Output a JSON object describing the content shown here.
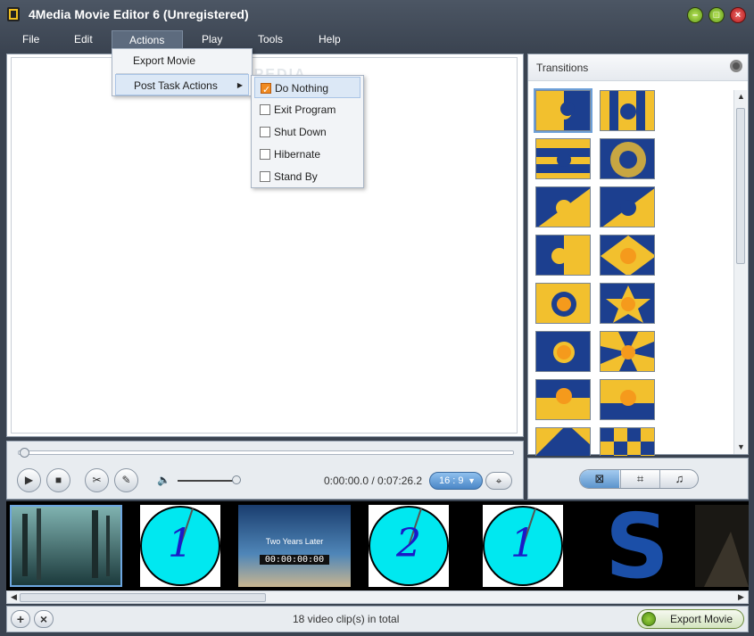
{
  "window": {
    "title": "4Media Movie Editor 6 (Unregistered)"
  },
  "menubar": [
    {
      "label": "File"
    },
    {
      "label": "Edit"
    },
    {
      "label": "Actions"
    },
    {
      "label": "Play"
    },
    {
      "label": "Tools"
    },
    {
      "label": "Help"
    }
  ],
  "actions_menu": {
    "items": [
      {
        "label": "Export Movie"
      },
      {
        "label": "Post Task Actions",
        "submenu_arrow": "▶"
      }
    ]
  },
  "post_task_menu": {
    "items": [
      {
        "label": "Do Nothing",
        "checked": true
      },
      {
        "label": "Exit Program",
        "checked": false
      },
      {
        "label": "Shut Down",
        "checked": false
      },
      {
        "label": "Hibernate",
        "checked": false
      },
      {
        "label": "Stand By",
        "checked": false
      }
    ]
  },
  "preview": {
    "watermark": "SOFTPEDIA"
  },
  "player": {
    "timecode": "0:00:00.0 / 0:07:26.2",
    "aspect_ratio": "16 : 9",
    "volume_level": 0.95,
    "seek_position": 0.0
  },
  "transitions": {
    "title": "Transitions",
    "tabs": [
      "transition-tab",
      "crop-tab",
      "music-tab"
    ]
  },
  "timeline": {
    "clips": [
      {
        "kind": "forest",
        "selected": true
      },
      {
        "kind": "clock",
        "numeral": "1"
      },
      {
        "kind": "beach",
        "caption": "Two Years Later",
        "timecode": "00:00:00:00"
      },
      {
        "kind": "clock",
        "numeral": "2"
      },
      {
        "kind": "clock",
        "numeral": "1"
      },
      {
        "kind": "letter",
        "glyph": "S"
      },
      {
        "kind": "dark"
      }
    ]
  },
  "footer": {
    "status": "18 video clip(s) in total",
    "export_label": "Export Movie"
  },
  "colors": {
    "accent_blue": "#5c94cc",
    "transition_yellow": "#f2c02e",
    "transition_navy": "#1c3f8f",
    "clock_cyan": "#00e8f0",
    "check_orange": "#f08a20"
  }
}
